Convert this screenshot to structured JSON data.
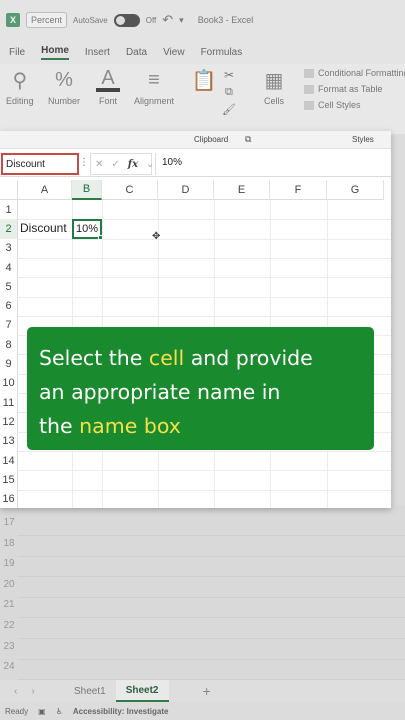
{
  "titlebar": {
    "format_chip": "Percent",
    "autosave_label": "AutoSave",
    "autosave_state": "Off",
    "document_title": "Book3 - Excel"
  },
  "ribbon_tabs": [
    "File",
    "Home",
    "Insert",
    "Data",
    "View",
    "Formulas"
  ],
  "ribbon_groups": {
    "editing": "Editing",
    "number": "Number",
    "font": "Font",
    "alignment": "Alignment",
    "cells": "Cells",
    "conditional_formatting": "Conditional Formatting",
    "format_as_table": "Format as Table",
    "cell_styles": "Cell Styles",
    "clipboard_group": "Clipboard",
    "styles_group": "Styles"
  },
  "name_box": {
    "value": "Discount"
  },
  "formula_bar": {
    "fx": "fx",
    "value": "10%"
  },
  "columns": [
    "A",
    "B",
    "C",
    "D",
    "E",
    "F",
    "G"
  ],
  "rows": [
    "1",
    "2",
    "3",
    "4",
    "5",
    "6",
    "7",
    "8",
    "9",
    "10",
    "11",
    "12",
    "13",
    "14",
    "15",
    "16"
  ],
  "rows_below": [
    "17",
    "18",
    "19",
    "20",
    "21",
    "22",
    "23",
    "24"
  ],
  "cells": {
    "A2": "Discount",
    "B2": "10%"
  },
  "callout": {
    "line1_pre": "Select the ",
    "line1_hl": "cell",
    "line1_post": " and provide",
    "line2": "an appropriate name in",
    "line3_pre": "the ",
    "line3_hl": "name box"
  },
  "sheets": {
    "sheet1": "Sheet1",
    "sheet2": "Sheet2",
    "active": "Sheet2"
  },
  "status": {
    "ready": "Ready",
    "accessibility": "Accessibility: Investigate"
  },
  "colors": {
    "excel_green": "#1f7a44",
    "callout_green": "#1a8a2e",
    "highlight_yellow": "#f4e04a",
    "namebox_border": "#c74b3f"
  }
}
